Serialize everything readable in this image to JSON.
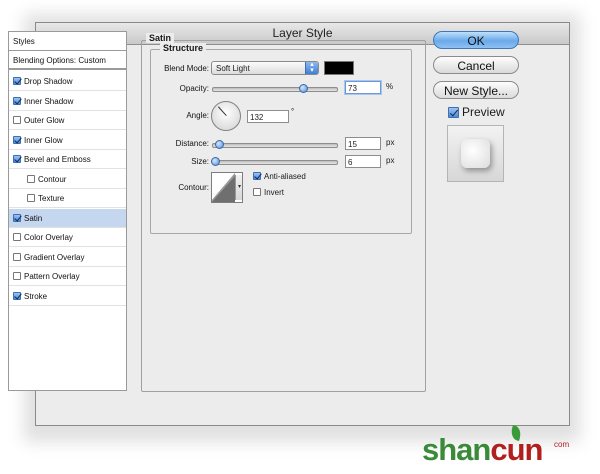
{
  "window": {
    "title": "Layer Style"
  },
  "sidebar": {
    "header": "Styles",
    "blending": "Blending Options: Custom",
    "items": [
      {
        "label": "Drop Shadow",
        "checked": true,
        "indent": false
      },
      {
        "label": "Inner Shadow",
        "checked": true,
        "indent": false
      },
      {
        "label": "Outer Glow",
        "checked": false,
        "indent": false
      },
      {
        "label": "Inner Glow",
        "checked": true,
        "indent": false
      },
      {
        "label": "Bevel and Emboss",
        "checked": true,
        "indent": false
      },
      {
        "label": "Contour",
        "checked": false,
        "indent": true
      },
      {
        "label": "Texture",
        "checked": false,
        "indent": true
      },
      {
        "label": "Satin",
        "checked": true,
        "indent": false,
        "selected": true
      },
      {
        "label": "Color Overlay",
        "checked": false,
        "indent": false
      },
      {
        "label": "Gradient Overlay",
        "checked": false,
        "indent": false
      },
      {
        "label": "Pattern Overlay",
        "checked": false,
        "indent": false
      },
      {
        "label": "Stroke",
        "checked": true,
        "indent": false
      }
    ]
  },
  "satin": {
    "title": "Satin",
    "structure_title": "Structure",
    "blend_mode_label": "Blend Mode:",
    "blend_mode_value": "Soft Light",
    "color": "#000000",
    "opacity_label": "Opacity:",
    "opacity_value": "73",
    "opacity_unit": "%",
    "opacity_level": 0.73,
    "angle_label": "Angle:",
    "angle_value": "132",
    "angle_unit": "°",
    "distance_label": "Distance:",
    "distance_value": "15",
    "distance_unit": "px",
    "distance_level": 0.06,
    "size_label": "Size:",
    "size_value": "6",
    "size_unit": "px",
    "size_level": 0.025,
    "contour_label": "Contour:",
    "anti_aliased_label": "Anti-aliased",
    "anti_aliased": true,
    "invert_label": "Invert",
    "invert": false
  },
  "buttons": {
    "ok": "OK",
    "cancel": "Cancel",
    "new_style": "New Style...",
    "preview_label": "Preview",
    "preview_checked": true
  },
  "watermark": {
    "brand_left": "shan",
    "brand_right": "cun",
    "sub": "com"
  },
  "colors": {
    "accent": "#4d8ad8",
    "selection": "#c5d6ef",
    "dialog_bg": "#ececec"
  }
}
